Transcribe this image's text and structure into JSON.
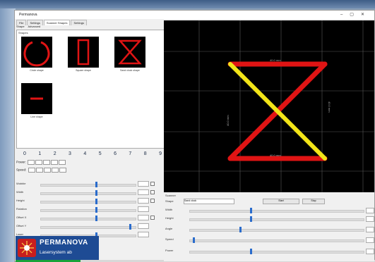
{
  "window": {
    "title": "Permanova"
  },
  "tabs": [
    "File",
    "Settings",
    "Scanner Shapes",
    "Settings"
  ],
  "subtabs": [
    "Shape",
    "Advanced"
  ],
  "shapes": {
    "panel_label": "Shapes",
    "tiles": [
      {
        "caption": "Circle shape"
      },
      {
        "caption": "Square shape"
      },
      {
        "caption": "Sand clock shape"
      },
      {
        "caption": "Line shape"
      }
    ]
  },
  "numbers": [
    "0",
    "1",
    "2",
    "3",
    "4",
    "5",
    "6",
    "7",
    "8",
    "9"
  ],
  "power_label": "Power:",
  "speed_label": "Speed:",
  "sliders": [
    {
      "label": "Wobble",
      "fraction": 0.58
    },
    {
      "label": "Width",
      "fraction": 0.58
    },
    {
      "label": "Height",
      "fraction": 0.58
    },
    {
      "label": "Rotation",
      "fraction": 0.58
    },
    {
      "label": "Offset X",
      "fraction": 0.58
    },
    {
      "label": "Offset Y",
      "fraction": 0.94
    },
    {
      "label": "Laser",
      "fraction": 0.58
    }
  ],
  "logo": {
    "line1": "PERMANOVA",
    "line2": "Lasersystem ab"
  },
  "progress": 0.18,
  "preview": {
    "labels": [
      "40.0 mm",
      "40.0 mm",
      "40.0 mm",
      "40.0 mm"
    ],
    "colors": {
      "red": "#e01414",
      "yellow": "#f2e418"
    }
  },
  "controls": {
    "title": "Scanner",
    "shape_label": "Shape",
    "shape_value": "Sand clock",
    "buttons": [
      "Start",
      "Stop"
    ],
    "rows": [
      {
        "label": "Width",
        "fraction": 0.35
      },
      {
        "label": "Height",
        "fraction": 0.35
      },
      {
        "label": "Angle",
        "fraction": 0.29
      },
      {
        "label": "Speed",
        "fraction": 0.02
      },
      {
        "label": "Power",
        "fraction": 0.35
      }
    ]
  }
}
